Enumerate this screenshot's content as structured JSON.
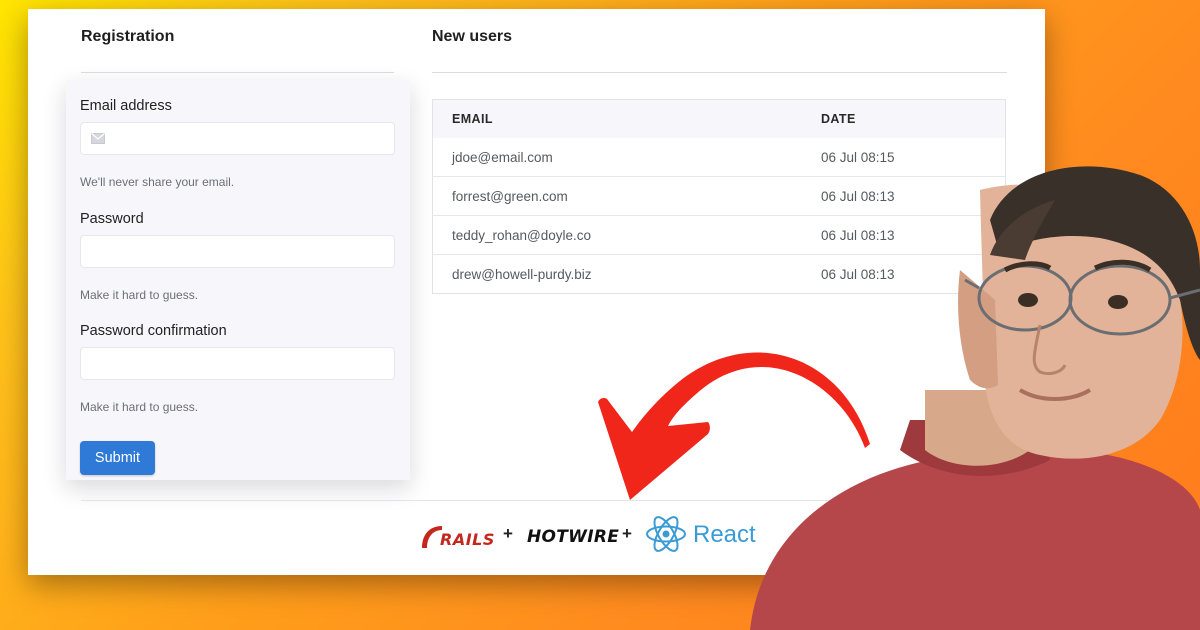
{
  "registration": {
    "title": "Registration",
    "email_label": "Email address",
    "email_value": "",
    "email_help": "We'll never share your email.",
    "password_label": "Password",
    "password_value": "",
    "password_help": "Make it hard to guess.",
    "confirm_label": "Password confirmation",
    "confirm_value": "",
    "confirm_help": "Make it hard to guess.",
    "submit_label": "Submit"
  },
  "users": {
    "title": "New users",
    "columns": [
      "EMAIL",
      "DATE"
    ],
    "rows": [
      {
        "email": "jdoe@email.com",
        "date": "06 Jul 08:15"
      },
      {
        "email": "forrest@green.com",
        "date": "06 Jul 08:13"
      },
      {
        "email": "teddy_rohan@doyle.co",
        "date": "06 Jul 08:13"
      },
      {
        "email": "drew@howell-purdy.biz",
        "date": "06 Jul 08:13"
      }
    ]
  },
  "footer": {
    "rails": "RAILS",
    "plus": "+",
    "hotwire": "HOTWIRE",
    "react": "React"
  },
  "icons": {
    "email_field": "mail-icon",
    "rails_logo": "rails-logo-icon",
    "react_logo": "react-logo-icon",
    "arrow": "curved-arrow-icon"
  },
  "colors": {
    "primary_button": "#2e7ad6",
    "arrow": "#f0261b",
    "rails": "#c4271b",
    "react": "#3a9bd5"
  }
}
